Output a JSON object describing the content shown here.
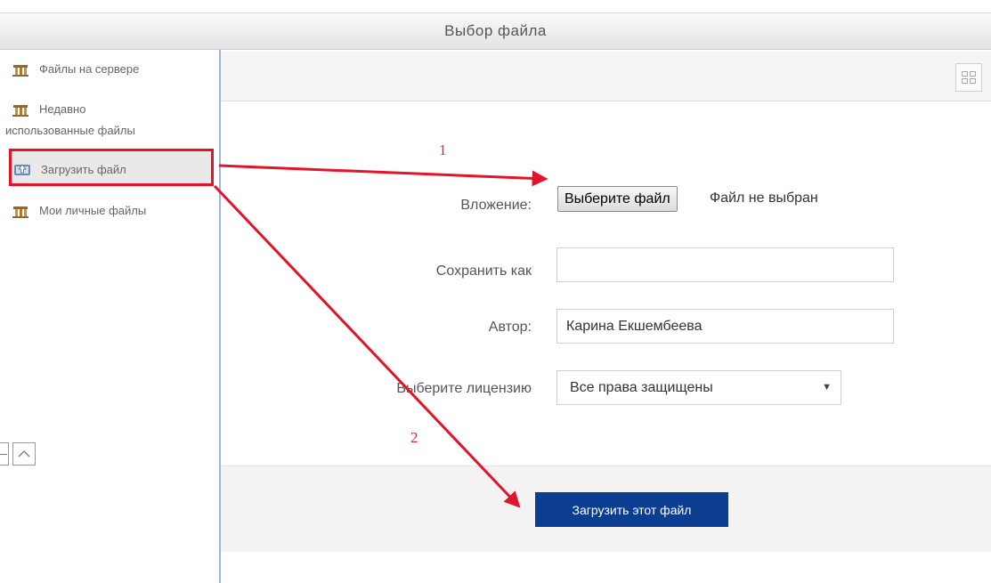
{
  "dialog": {
    "title": "Выбор файла"
  },
  "sidebar": {
    "items": [
      {
        "label": "Файлы на сервере",
        "icon": "repository-icon"
      },
      {
        "label_line1": "Недавно",
        "label_line2": "использованные файлы",
        "icon": "repository-icon"
      },
      {
        "label": "Загрузить файл",
        "icon": "upload-icon"
      },
      {
        "label": "Мои личные файлы",
        "icon": "repository-icon"
      }
    ]
  },
  "form": {
    "attachment_label": "Вложение:",
    "choose_file_button": "Выберите файл",
    "no_file_text": "Файл не выбран",
    "save_as_label": "Сохранить как",
    "save_as_value": "",
    "author_label": "Автор:",
    "author_value": "Карина Екшембеева",
    "license_label": "Выберите лицензию",
    "license_value": "Все права защищены"
  },
  "footer": {
    "upload_button": "Загрузить этот файл"
  },
  "annotations": {
    "step1": "1",
    "step2": "2"
  },
  "colors": {
    "annotation": "#e2142a",
    "primary_button": "#0b3d91",
    "divider": "#9fb6d9"
  }
}
